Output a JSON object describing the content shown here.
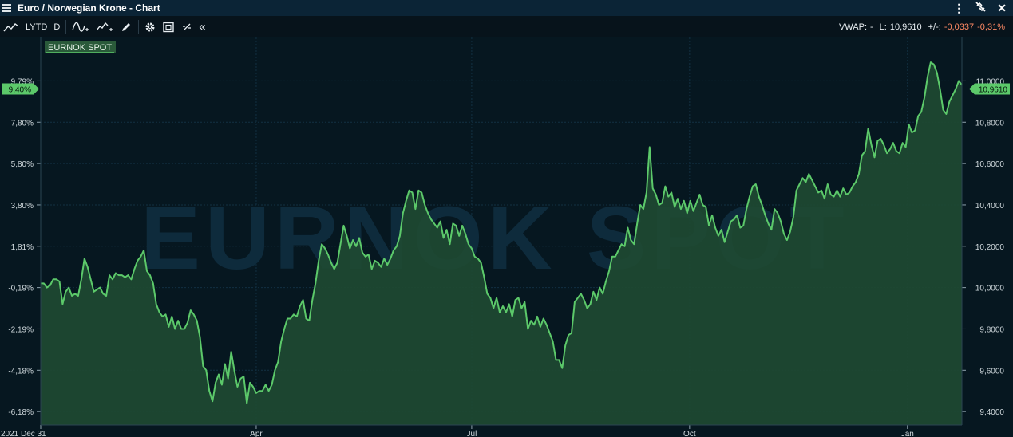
{
  "window": {
    "title": "Euro / Norwegian Krone - Chart"
  },
  "toolbar": {
    "period_label": "LYTD",
    "interval_label": "D",
    "vwap_label": "VWAP:",
    "vwap_value": "-",
    "last_label": "L:",
    "last_value": "10,9610",
    "change_label": "+/-:",
    "change_value": "-0,0337",
    "change_pct": "-0,31%",
    "negative_color": "#ff8a65"
  },
  "chart_data": {
    "type": "area",
    "series": [
      {
        "name": "EURNOK SPOT",
        "color": "#5cc96a"
      }
    ],
    "watermark": "EURNOK SPOT",
    "x_range": [
      "2021-12-31",
      "2023-01-24"
    ],
    "x_ticks": [
      "2021 Dec 31",
      "Apr",
      "Jul",
      "Oct",
      "Jan"
    ],
    "y_ticks_right": [
      "9,4000",
      "9,6000",
      "9,8000",
      "10,0000",
      "10,2000",
      "10,4000",
      "10,6000",
      "10,8000",
      "11,0000"
    ],
    "y_ticks_left": [
      "-6,18%",
      "-4,18%",
      "-2,19%",
      "-0,19%",
      "1,81%",
      "3,80%",
      "5,80%",
      "7,80%",
      "9,79%"
    ],
    "ylim": [
      9.335,
      11.21
    ],
    "last_value_label": "10,9610",
    "last_pct_label": "9,40%",
    "last_value": 10.961,
    "grid": true,
    "values": [
      10.02,
      10.02,
      10.0,
      10.01,
      10.04,
      10.04,
      10.03,
      9.92,
      9.98,
      10.0,
      9.96,
      9.97,
      9.96,
      10.04,
      10.14,
      10.1,
      10.04,
      9.98,
      9.99,
      10.0,
      9.97,
      9.96,
      10.06,
      10.04,
      10.07,
      10.06,
      10.06,
      10.05,
      10.06,
      10.04,
      10.09,
      10.13,
      10.15,
      10.18,
      10.08,
      10.06,
      10.02,
      9.92,
      9.88,
      9.86,
      9.87,
      9.81,
      9.86,
      9.8,
      9.84,
      9.8,
      9.8,
      9.83,
      9.89,
      9.87,
      9.84,
      9.76,
      9.62,
      9.6,
      9.5,
      9.45,
      9.54,
      9.58,
      9.53,
      9.63,
      9.56,
      9.69,
      9.6,
      9.52,
      9.56,
      9.57,
      9.44,
      9.54,
      9.52,
      9.49,
      9.5,
      9.5,
      9.53,
      9.5,
      9.53,
      9.6,
      9.64,
      9.74,
      9.8,
      9.85,
      9.85,
      9.87,
      9.86,
      9.91,
      9.94,
      9.85,
      9.84,
      9.94,
      10.02,
      10.13,
      10.21,
      10.19,
      10.16,
      10.12,
      10.09,
      10.12,
      10.21,
      10.3,
      10.25,
      10.19,
      10.23,
      10.2,
      10.24,
      10.17,
      10.15,
      10.16,
      10.09,
      10.13,
      10.12,
      10.1,
      10.14,
      10.11,
      10.14,
      10.18,
      10.2,
      10.25,
      10.36,
      10.42,
      10.47,
      10.46,
      10.38,
      10.47,
      10.46,
      10.4,
      10.36,
      10.33,
      10.31,
      10.29,
      10.32,
      10.24,
      10.28,
      10.21,
      10.31,
      10.3,
      10.25,
      10.3,
      10.26,
      10.21,
      10.19,
      10.15,
      10.14,
      10.12,
      10.05,
      9.97,
      9.95,
      9.9,
      9.95,
      9.88,
      9.91,
      9.88,
      9.92,
      9.86,
      9.94,
      9.95,
      9.9,
      9.93,
      9.8,
      9.84,
      9.82,
      9.86,
      9.81,
      9.85,
      9.82,
      9.78,
      9.74,
      9.65,
      9.65,
      9.61,
      9.72,
      9.77,
      9.78,
      9.93,
      9.95,
      9.97,
      9.94,
      9.9,
      9.92,
      9.98,
      9.94,
      10.0,
      9.97,
      10.03,
      10.08,
      10.15,
      10.15,
      10.18,
      10.21,
      10.2,
      10.29,
      10.23,
      10.21,
      10.31,
      10.4,
      10.38,
      10.46,
      10.68,
      10.48,
      10.45,
      10.4,
      10.41,
      10.49,
      10.44,
      10.46,
      10.39,
      10.43,
      10.38,
      10.42,
      10.36,
      10.42,
      10.37,
      10.41,
      10.45,
      10.4,
      10.39,
      10.3,
      10.35,
      10.29,
      10.25,
      10.28,
      10.22,
      10.27,
      10.32,
      10.33,
      10.35,
      10.29,
      10.3,
      10.38,
      10.44,
      10.49,
      10.5,
      10.44,
      10.4,
      10.35,
      10.31,
      10.28,
      10.38,
      10.36,
      10.32,
      10.26,
      10.23,
      10.27,
      10.34,
      10.47,
      10.5,
      10.53,
      10.51,
      10.55,
      10.52,
      10.49,
      10.46,
      10.47,
      10.43,
      10.5,
      10.45,
      10.44,
      10.47,
      10.44,
      10.48,
      10.45,
      10.46,
      10.49,
      10.51,
      10.55,
      10.64,
      10.66,
      10.77,
      10.69,
      10.63,
      10.71,
      10.72,
      10.69,
      10.65,
      10.67,
      10.7,
      10.66,
      10.65,
      10.7,
      10.68,
      10.79,
      10.75,
      10.76,
      10.83,
      10.85,
      10.92,
      11.02,
      11.09,
      11.08,
      11.04,
      10.96,
      10.86,
      10.84,
      10.9,
      10.93,
      10.96,
      11.0,
      10.98
    ]
  }
}
